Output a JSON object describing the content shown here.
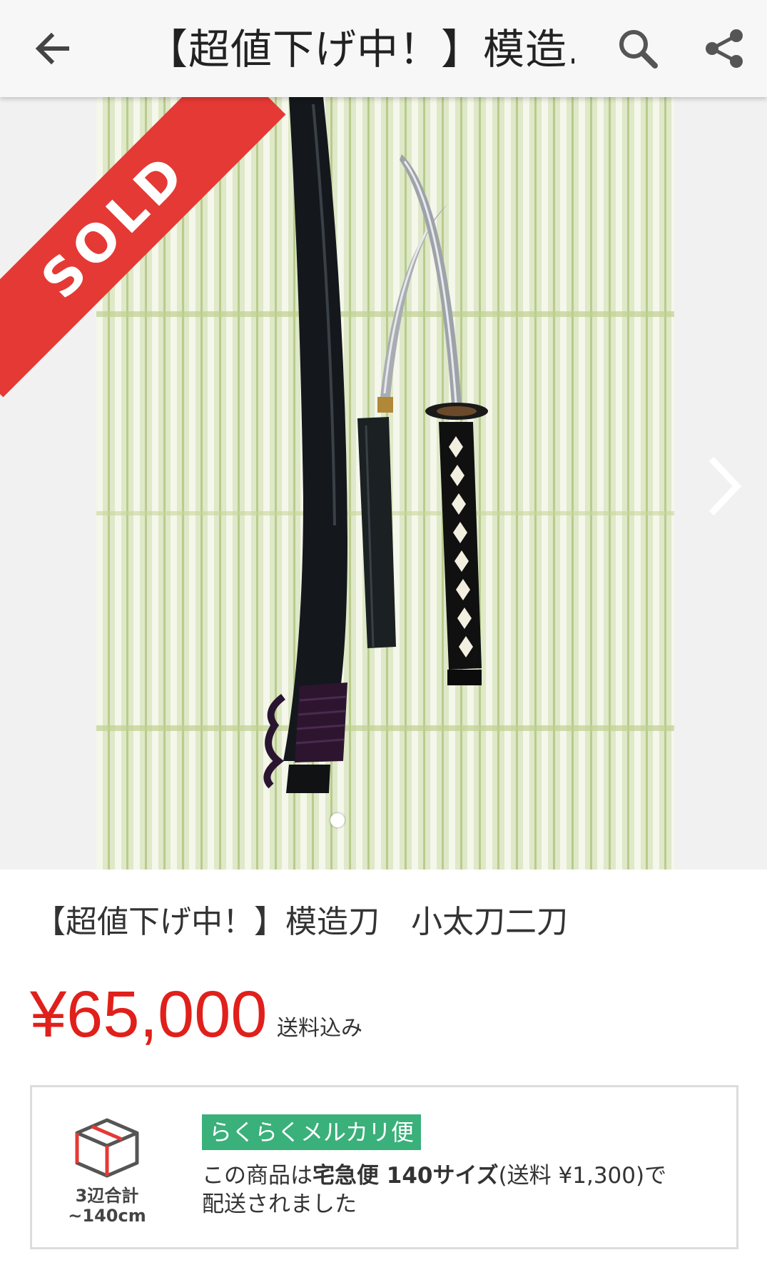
{
  "header": {
    "title": "【超値下げ中！】模造...",
    "back_icon": "arrow-left-icon",
    "search_icon": "search-icon",
    "share_icon": "share-icon"
  },
  "carousel": {
    "badge": "SOLD",
    "badge_color": "#e53935",
    "next_icon": "chevron-right-icon",
    "page_indicator": {
      "current": 1
    }
  },
  "product": {
    "name": "【超値下げ中！】模造刀　小太刀二刀",
    "price": "¥65,000",
    "price_color": "#e0201b",
    "shipping_included": "送料込み"
  },
  "shipping": {
    "icon": "package-box-icon",
    "size_label_line1": "3辺合計",
    "size_label_line2": "~140cm",
    "method_badge": "らくらくメルカリ便",
    "badge_color": "#3ab07a",
    "desc_prefix": "この商品は",
    "desc_bold": "宅急便 140サイズ",
    "desc_suffix": "(送料 ¥1,300)で",
    "desc_line2": "配送されました"
  }
}
